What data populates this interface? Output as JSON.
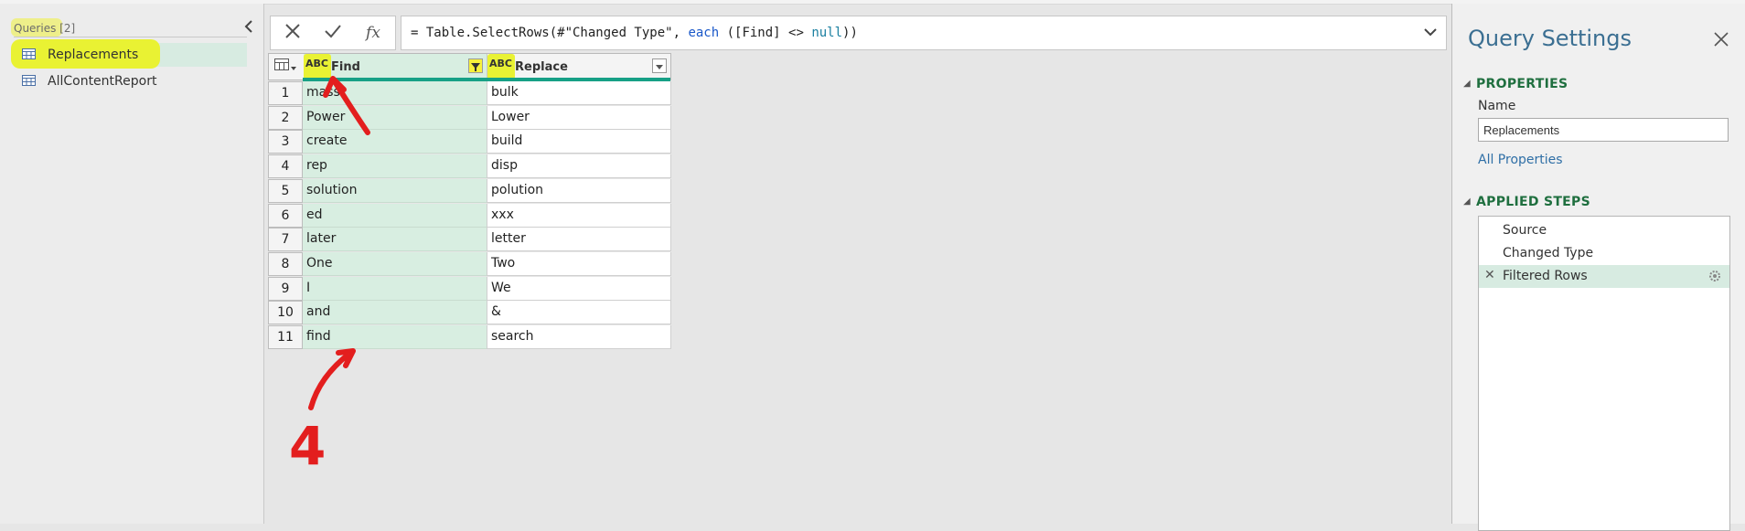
{
  "queries": {
    "header": "Queries [2]",
    "items": [
      {
        "label": "Replacements",
        "selected": true
      },
      {
        "label": "AllContentReport",
        "selected": false
      }
    ]
  },
  "formula_bar": {
    "cancel_icon": "x-icon",
    "commit_icon": "check-icon",
    "fx_label": "fx",
    "formula_prefix": "= Table.SelectRows(#\"Changed Type\", ",
    "formula_kw_each": "each",
    "formula_mid": " ([Find] <> ",
    "formula_null": "null",
    "formula_suffix": "))"
  },
  "grid": {
    "columns": [
      {
        "name": "Find",
        "type_icon": "ABC",
        "filtered": true
      },
      {
        "name": "Replace",
        "type_icon": "ABC",
        "filtered": false
      }
    ],
    "rows": [
      {
        "n": "1",
        "find": "mass",
        "replace": "bulk"
      },
      {
        "n": "2",
        "find": "Power",
        "replace": "Lower"
      },
      {
        "n": "3",
        "find": "create",
        "replace": "build"
      },
      {
        "n": "4",
        "find": "rep",
        "replace": "disp"
      },
      {
        "n": "5",
        "find": "solution",
        "replace": "polution"
      },
      {
        "n": "6",
        "find": "ed",
        "replace": "xxx"
      },
      {
        "n": "7",
        "find": "later",
        "replace": "letter"
      },
      {
        "n": "8",
        "find": "One",
        "replace": "Two"
      },
      {
        "n": "9",
        "find": "I",
        "replace": "We"
      },
      {
        "n": "10",
        "find": "and",
        "replace": "&"
      },
      {
        "n": "11",
        "find": "find",
        "replace": "search"
      }
    ]
  },
  "annotation": {
    "handwritten_number": "4",
    "color": "#e31e1e",
    "highlight_color": "#e9f233"
  },
  "settings": {
    "title": "Query Settings",
    "properties_header": "PROPERTIES",
    "name_label": "Name",
    "name_value": "Replacements",
    "all_properties_link": "All Properties",
    "applied_steps_header": "APPLIED STEPS",
    "steps": [
      {
        "label": "Source",
        "selected": false
      },
      {
        "label": "Changed Type",
        "selected": false
      },
      {
        "label": "Filtered Rows",
        "selected": true
      }
    ]
  },
  "colors": {
    "selection_green": "#d7ebe1",
    "column_underline": "#17a086",
    "section_header": "#1f6f3f",
    "title_blue": "#3b6f92"
  }
}
